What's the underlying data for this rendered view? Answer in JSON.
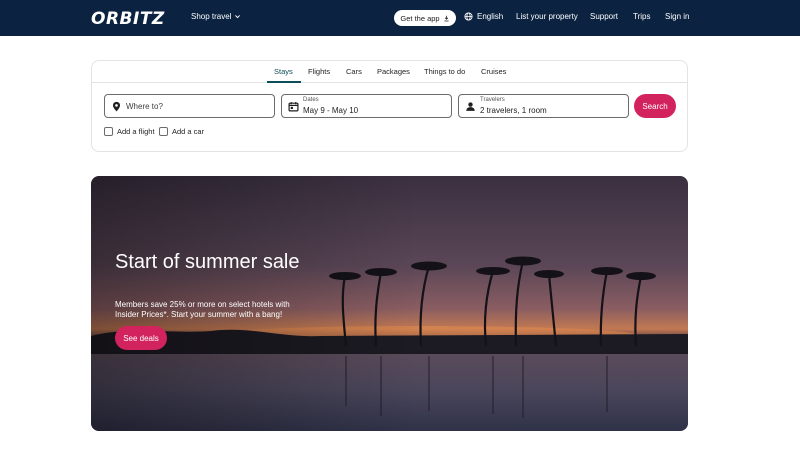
{
  "header": {
    "logo": "ORBITZ",
    "shop_travel": "Shop travel",
    "get_app": "Get the app",
    "language": "English",
    "list_property": "List your property",
    "support": "Support",
    "trips": "Trips",
    "sign_in": "Sign in"
  },
  "search": {
    "tabs": [
      "Stays",
      "Flights",
      "Cars",
      "Packages",
      "Things to do",
      "Cruises"
    ],
    "active_tab": "Stays",
    "destination_placeholder": "Where to?",
    "dates_label": "Dates",
    "dates_value": "May 9 - May 10",
    "travelers_label": "Travelers",
    "travelers_value": "2 travelers, 1 room",
    "search_button": "Search",
    "add_flight": "Add a flight",
    "add_car": "Add a car"
  },
  "hero": {
    "title": "Start of summer sale",
    "subtitle": "Members save 25% or more on select hotels with Insider Prices*. Start your summer with a bang!",
    "cta": "See deals"
  },
  "colors": {
    "header_bg": "#0b2341",
    "accent": "#d2235f",
    "tab_active": "#0b4d58"
  },
  "icons": [
    "download-icon",
    "globe-icon",
    "chevron-down-icon",
    "location-pin-icon",
    "calendar-icon",
    "person-icon"
  ]
}
